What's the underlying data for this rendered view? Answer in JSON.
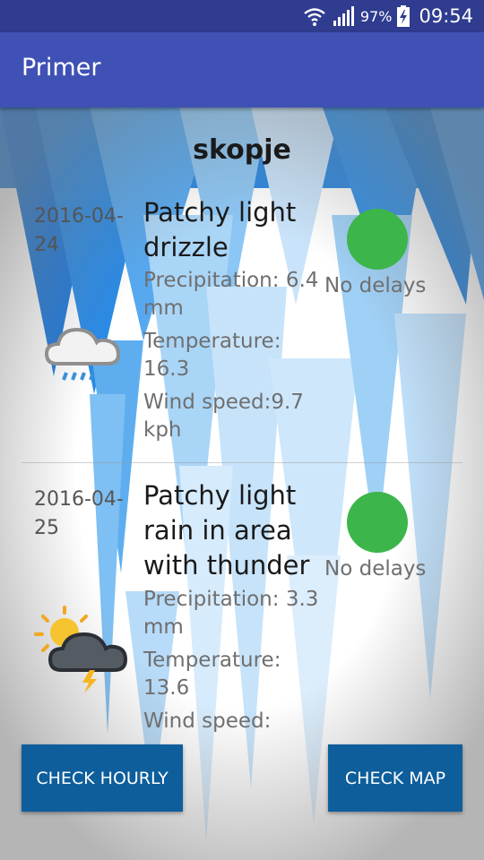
{
  "status_bar": {
    "battery": "97%",
    "time": "09:54"
  },
  "app_bar": {
    "title": "Primer"
  },
  "city": "skopje",
  "forecasts": [
    {
      "date": "2016-04-24",
      "condition": "Patchy light drizzle",
      "precipitation": "Precipitation: 6.4 mm",
      "temperature": "Temperature: 16.3",
      "wind": "Wind speed:9.7 kph",
      "status": "No delays",
      "status_color": "#3cb54a",
      "icon": "cloud-drizzle-icon"
    },
    {
      "date": "2016-04-25",
      "condition": "Patchy light rain in area with thunder",
      "precipitation": "Precipitation: 3.3 mm",
      "temperature": "Temperature: 13.6",
      "wind": "Wind speed:",
      "status": "No delays",
      "status_color": "#3cb54a",
      "icon": "sun-cloud-thunder-icon"
    }
  ],
  "buttons": {
    "hourly": "CHECK HOURLY",
    "map": "CHECK MAP"
  }
}
